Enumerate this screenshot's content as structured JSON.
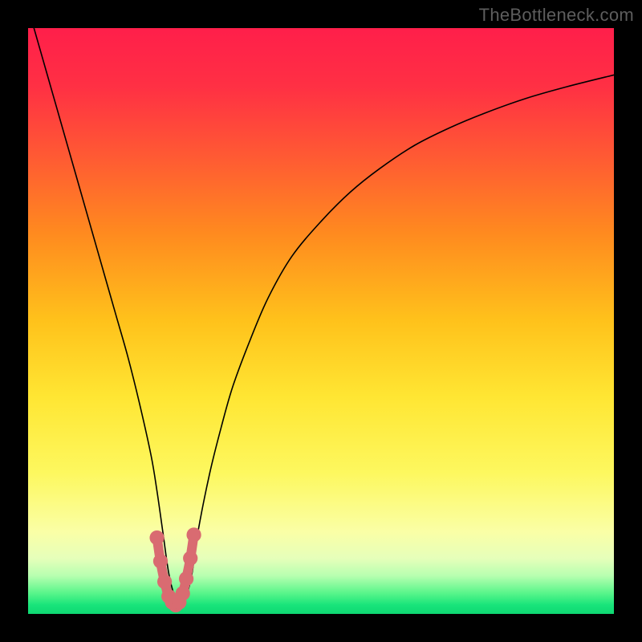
{
  "watermark": "TheBottleneck.com",
  "colors": {
    "frame": "#000000",
    "curve": "#000000",
    "marker_fill": "#d96b71",
    "marker_stroke": "#d96b71",
    "gradient_stops": [
      {
        "offset": 0.0,
        "color": "#ff1f4a"
      },
      {
        "offset": 0.1,
        "color": "#ff3044"
      },
      {
        "offset": 0.22,
        "color": "#ff5a33"
      },
      {
        "offset": 0.35,
        "color": "#ff8a1f"
      },
      {
        "offset": 0.5,
        "color": "#ffc21b"
      },
      {
        "offset": 0.63,
        "color": "#ffe633"
      },
      {
        "offset": 0.76,
        "color": "#fdf85f"
      },
      {
        "offset": 0.86,
        "color": "#faffa6"
      },
      {
        "offset": 0.905,
        "color": "#e6ffba"
      },
      {
        "offset": 0.935,
        "color": "#b7ffb0"
      },
      {
        "offset": 0.965,
        "color": "#57f58a"
      },
      {
        "offset": 0.985,
        "color": "#18e47a"
      },
      {
        "offset": 1.0,
        "color": "#0fd873"
      }
    ]
  },
  "chart_data": {
    "type": "line",
    "title": "",
    "xlabel": "",
    "ylabel": "",
    "xlim": [
      0,
      100
    ],
    "ylim": [
      0,
      100
    ],
    "grid": false,
    "series": [
      {
        "name": "bottleneck-curve",
        "x": [
          1,
          3,
          5,
          7,
          9,
          11,
          13,
          15,
          17,
          19,
          21,
          22,
          23,
          24,
          25,
          26,
          27,
          28,
          29,
          31,
          33,
          35,
          38,
          41,
          45,
          50,
          55,
          60,
          66,
          72,
          78,
          85,
          92,
          100
        ],
        "y": [
          100,
          93,
          86,
          79,
          72,
          65,
          58,
          51,
          44,
          36,
          27,
          21,
          14,
          7,
          3,
          1,
          3,
          7,
          14,
          24,
          32,
          39,
          47,
          54,
          61,
          67,
          72,
          76,
          80,
          83,
          85.5,
          88,
          90,
          92
        ]
      }
    ],
    "markers": {
      "name": "highlighted-minimum",
      "x": [
        22.0,
        22.6,
        23.3,
        24.0,
        24.6,
        25.2,
        25.8,
        26.4,
        27.0,
        27.7,
        28.3
      ],
      "y": [
        13.0,
        9.0,
        5.5,
        3.0,
        2.0,
        1.5,
        2.0,
        3.5,
        6.0,
        9.5,
        13.5
      ]
    }
  }
}
